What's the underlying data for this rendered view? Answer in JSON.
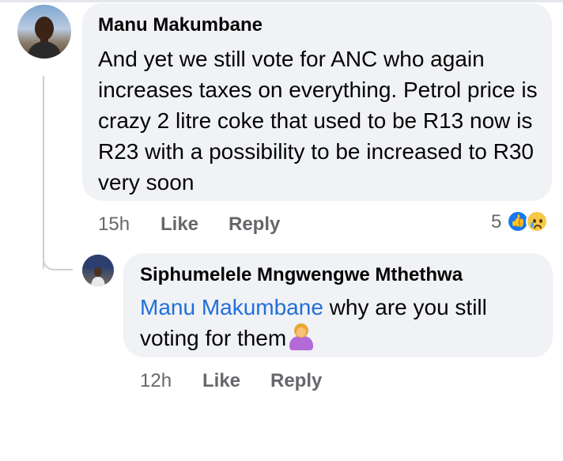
{
  "comment": {
    "author": "Manu Makumbane",
    "text": "And yet we still vote for ANC who again increases taxes on everything. Petrol price is crazy 2 litre coke that used to be R13 now is R23 with a possibility to be increased to R30 very soon",
    "time": "15h",
    "like_label": "Like",
    "reply_label": "Reply",
    "reaction_count": "5",
    "reaction_icons": [
      "like-icon",
      "sad-icon"
    ]
  },
  "reply": {
    "author": "Siphumelele Mngwengwe Mthethwa",
    "mention": "Manu Makumbane",
    "text": " why are you still voting for them",
    "emoji": "person-shrugging-icon",
    "time": "12h",
    "like_label": "Like",
    "reply_label": "Reply"
  },
  "colors": {
    "bubble": "#f0f2f5",
    "mention": "#216fdb",
    "meta": "#65676b",
    "like_blue": "#1877f2"
  }
}
